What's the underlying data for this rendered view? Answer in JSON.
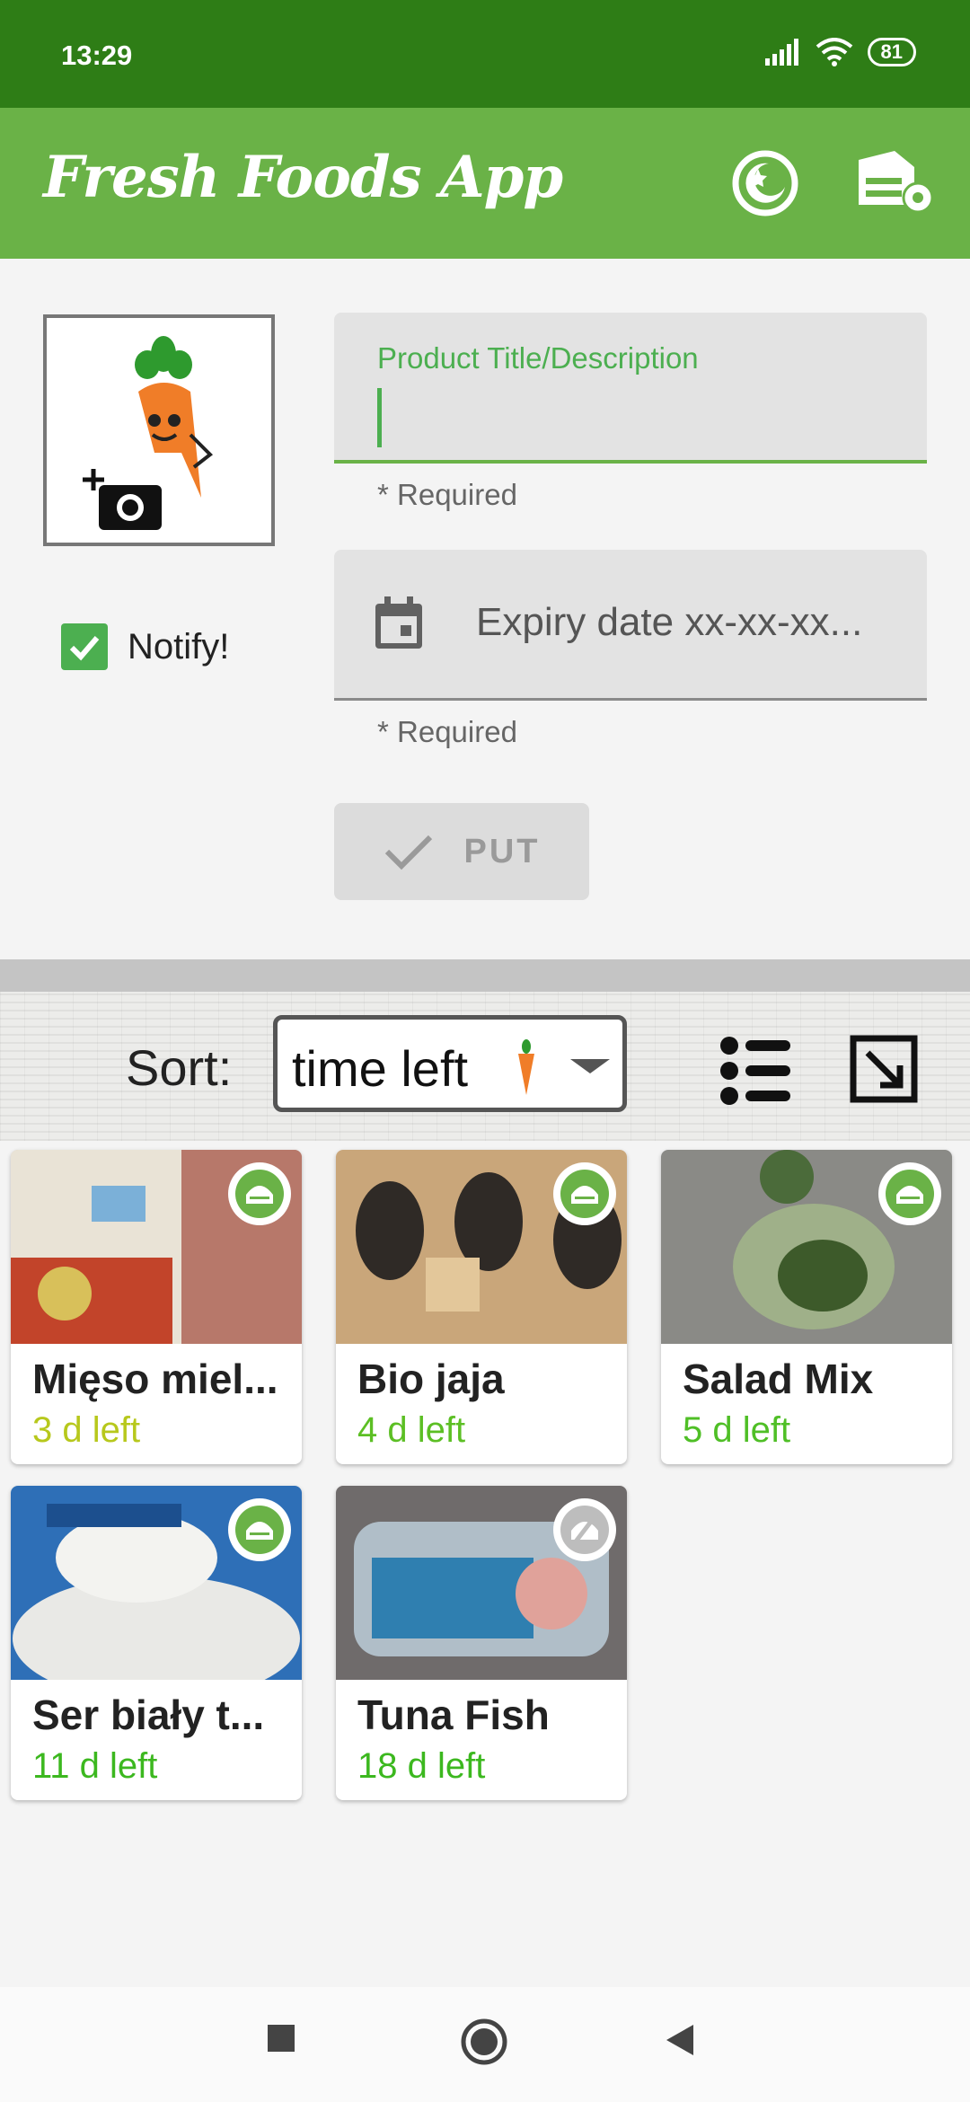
{
  "status_bar": {
    "time": "13:29",
    "battery": "81"
  },
  "app_bar": {
    "title": "Fresh Foods App",
    "icons": [
      "night-mode-icon",
      "settings-storage-icon"
    ]
  },
  "form": {
    "photo_icon": "add-photo-carrot-icon",
    "notify_label": "Notify!",
    "notify_checked": true,
    "title_field": {
      "label": "Product Title/Description",
      "value": ""
    },
    "title_helper": "* Required",
    "expiry_field": {
      "icon": "calendar-icon",
      "placeholder": "Expiry date xx-xx-xx..."
    },
    "expiry_helper": "* Required",
    "put_button": {
      "icon": "check-icon",
      "label": "PUT"
    }
  },
  "sort": {
    "label": "Sort:",
    "selected": "time left",
    "icons": [
      "list-icon",
      "expand-icon"
    ]
  },
  "colors": {
    "primary": "#6ab247",
    "primary_dark": "#2e7d16",
    "left_yellow": "#b7c81c",
    "left_green": "#4fbf26"
  },
  "products": [
    {
      "name": "Mięso miel...",
      "left": "3 d left",
      "badge": "storage-icon",
      "color": "#b7c81c"
    },
    {
      "name": "Bio jaja",
      "left": "4 d left",
      "badge": "storage-icon",
      "color": "#5cbf24"
    },
    {
      "name": "Salad Mix",
      "left": "5 d left",
      "badge": "storage-icon",
      "color": "#4fbf26"
    },
    {
      "name": "Ser biały t...",
      "left": "11 d left",
      "badge": "storage-icon",
      "color": "#3cb81f"
    },
    {
      "name": "Tuna Fish",
      "left": "18 d left",
      "badge": "storage-off-icon",
      "color": "#3cb81f"
    }
  ]
}
